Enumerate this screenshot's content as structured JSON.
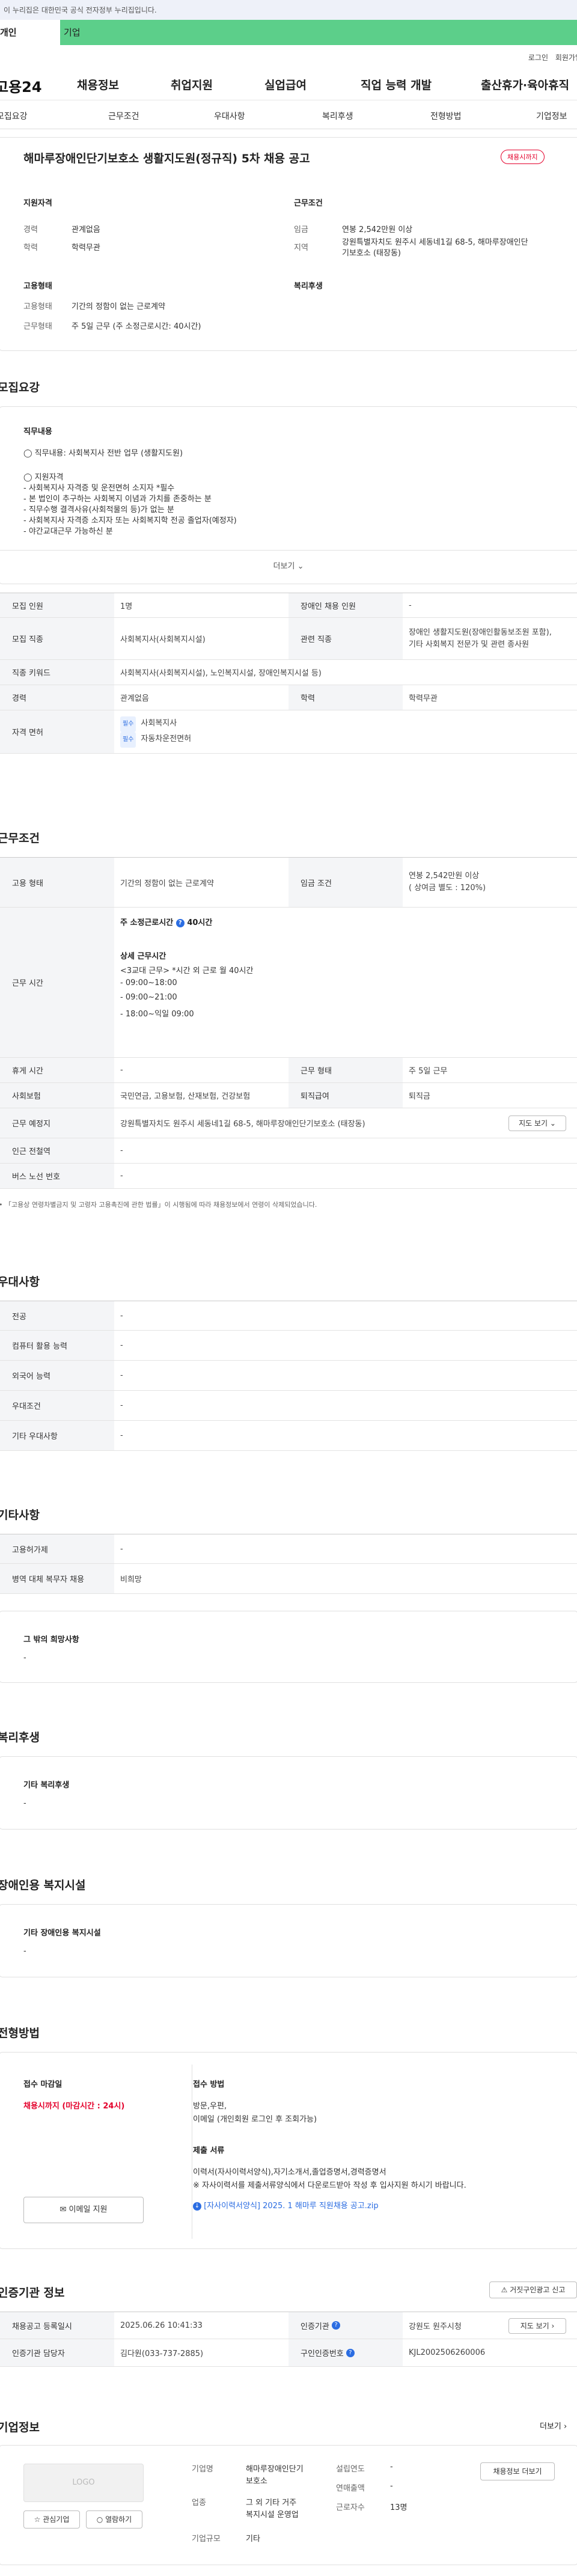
{
  "notice": "이 누리집은 대한민국 공식 전자정부 누리집입니다.",
  "category_tabs": [
    "개인",
    "기업"
  ],
  "util_links": [
    "로그인",
    "회원가입"
  ],
  "logo": "고용24",
  "gnb": [
    "채용정보",
    "취업지원",
    "실업급여",
    "직업 능력 개발",
    "출산휴가·육아휴직"
  ],
  "subnav": [
    "모집요강",
    "근무조건",
    "우대사항",
    "복리후생",
    "전형방법",
    "기업정보"
  ],
  "job": {
    "title": "해마루장애인단기보호소 생활지도원(정규직) 5차 채용 공고",
    "badge": "채용시까지",
    "qualification_title": "지원자격",
    "career_label": "경력",
    "career_value": "관계없음",
    "education_label": "학력",
    "education_value": "학력무관",
    "employment_title": "고용형태",
    "employment_label": "고용형태",
    "employment_value": "기간의 정함이 없는 근로계약",
    "worktype_label": "근무형태",
    "worktype_value": "주 5일 근무 (주 소정근로시간: 40시간)",
    "conditions_title": "근무조건",
    "wage_label": "임금",
    "wage_value": "연봉 2,542만원 이상",
    "region_label": "지역",
    "region_value": "강원특별자치도 원주시 세동네1길 68-5, 해마루장애인단기보호소 (태장동)",
    "welfare_title": "복리후생"
  },
  "recruit": {
    "section_title": "모집요강",
    "duty_title": "직무내용",
    "duty_line": "◯ 직무내용: 사회복지사 전반 업무 (생활지도원)",
    "qual_lines": [
      "◯ 지원자격",
      "- 사회복지사 자격증 및 운전면허 소지자 *필수",
      "- 본 법인이 추구하는 사회복지 이념과 가치를 존중하는 분",
      "- 직무수행 결격사유(사회적물의 등)가 없는 분",
      "- 사회복지사 자격증 소지자 또는 사회복지학 전공 졸업자(예정자)",
      "- 야간교대근무 가능하신 분"
    ],
    "more_label": "더보기",
    "rows": {
      "count_label": "모집 인원",
      "count_value": "1명",
      "disabled_label": "장애인 채용 인원",
      "disabled_value": "-",
      "job_label": "모집 직종",
      "job_value": "사회복지사(사회복지시설)",
      "related_label": "관련 직종",
      "related_value_1": "장애인 생활지도원(장애인활동보조원 포함),",
      "related_value_2": "기타 사회복지 전문가 및 관련 종사원",
      "keyword_label": "직종 키워드",
      "keyword_value": "사회복지사(사회복지시설), 노인복지시설, 장애인복지시설 등)",
      "career_label": "경력",
      "career_value": "관계없음",
      "edu_label": "학력",
      "edu_value": "학력무관",
      "license_label": "자격 면허",
      "license_tag": "필수",
      "license_1": "사회복지사",
      "license_2": "자동차운전면허"
    }
  },
  "work": {
    "section_title": "근무조건",
    "emp_label": "고용 형태",
    "emp_value": "기간의 정함이 없는 근로계약",
    "wage_label": "임금 조건",
    "wage_value_1": "연봉 2,542만원 이상",
    "wage_value_2": "( 상여금 별도 : 120%)",
    "hours_label": "근무 시간",
    "hours_main": "주 소정근로시간",
    "hours_main_value": "40시간",
    "hours_detail_title": "상세 근무시간",
    "hours_lines": [
      "<3교대 근무> *시간 외 근로 월 40시간",
      "- 09:00~18:00",
      "- 09:00~21:00",
      "- 18:00~익일 09:00"
    ],
    "rest_label": "휴게 시간",
    "rest_value": "-",
    "form_label": "근무 형태",
    "form_value": "주 5일 근무",
    "insurance_label": "사회보험",
    "insurance_value": "국민연금, 고용보험, 산재보험, 건강보험",
    "severance_label": "퇴직급여",
    "severance_value": "퇴직금",
    "place_label": "근무 예정지",
    "place_value": "강원특별자치도 원주시 세동네1길 68-5, 해마루장애인단기보호소 (태장동)",
    "map_button": "지도 보기",
    "subway_label": "인근 전철역",
    "subway_value": "-",
    "bus_label": "버스 노선 번호",
    "bus_value": "-",
    "footnote": "「고용상 연령차별금지 및 고령자 고용촉진에 관한 법률」이 시행됨에 따라 채용정보에서 연령이 삭제되었습니다."
  },
  "pref": {
    "section_title": "우대사항",
    "rows": [
      {
        "label": "전공",
        "value": "-"
      },
      {
        "label": "컴퓨터 활용 능력",
        "value": "-"
      },
      {
        "label": "외국어 능력",
        "value": "-"
      },
      {
        "label": "우대조건",
        "value": "-"
      },
      {
        "label": "기타 우대사항",
        "value": "-"
      }
    ]
  },
  "other": {
    "section_title": "기타사항",
    "rows": [
      {
        "label": "고용허가제",
        "value": "-"
      },
      {
        "label": "병역 대체 복무자 채용",
        "value": "비희망"
      }
    ],
    "extra_title": "그 밖의 희망사항",
    "extra_value": "-"
  },
  "welfare": {
    "section_title": "복리후생",
    "box_title": "기타 복리후생",
    "box_value": "-"
  },
  "disabled_facility": {
    "section_title": "장애인용 복지시설",
    "box_title": "기타 장애인용 복지시설",
    "box_value": "-"
  },
  "selection": {
    "section_title": "전형방법",
    "deadline_title": "접수 마감일",
    "deadline_value": "채용시까지 (마감시간 : 24시)",
    "email_button": "이메일 지원",
    "method_title": "접수 방법",
    "method_lines": [
      "방문,우편,",
      "이메일 (개인회원 로그인 후 조회가능)"
    ],
    "docs_title": "제출 서류",
    "docs_lines": [
      "이력서(자사이력서양식),자기소개서,졸업증명서,경력증명서",
      "※ 자사이력서를 제출서류양식에서 다운로드받아 작성 후 입사지원 하시기 바랍니다."
    ],
    "file_link": "[자사이력서양식] 2025. 1 해마루 직원채용 공고.zip"
  },
  "agency": {
    "section_title": "인증기관 정보",
    "report_button": "거짓구인광고 신고",
    "reg_date_label": "채용공고 등록일시",
    "reg_date_value": "2025.06.26 10:41:33",
    "agency_label": "인증기관",
    "agency_value": "강원도 원주시청",
    "map_button": "지도 보기",
    "manager_label": "인증기관 담당자",
    "manager_value": "김다원(033-737-2885)",
    "notice_no_label": "구인인증번호",
    "notice_no_value": "KJL2002506260006"
  },
  "company": {
    "section_title": "기업정보",
    "more_link": "더보기",
    "logo_text": "LOGO",
    "interest_button": "관심기업",
    "subscribe_button": "열람하기",
    "name_label": "기업명",
    "name_value_1": "해마루장애인단기",
    "name_value_2": "보호소",
    "industry_label": "업종",
    "industry_value_1": "그 외 기타 거주",
    "industry_value_2": "복지시설 운영업",
    "size_label": "기업규모",
    "size_value": "기타",
    "founded_label": "설립연도",
    "founded_value": "-",
    "sales_label": "연매출액",
    "sales_value": "-",
    "staff_label": "근로자수",
    "staff_value": "13명",
    "jobs_button": "채용정보 더보기"
  },
  "colors": {
    "accent": "#2b6de2",
    "brand_green": "#5ccf8a",
    "alert_red": "#e4002b"
  }
}
